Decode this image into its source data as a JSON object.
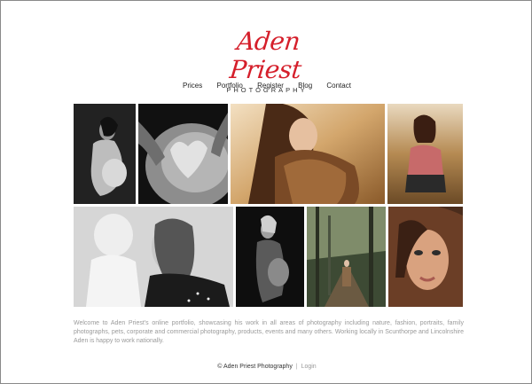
{
  "brand": {
    "name": "Aden Priest",
    "tagline": "PHOTOGRAPHY"
  },
  "nav": [
    "Prices",
    "Portfolio",
    "Register",
    "Blog",
    "Contact"
  ],
  "gallery": [
    {
      "name": "photo-pregnant-woman-silhouette",
      "tone": "mono"
    },
    {
      "name": "photo-hands-heart-on-belly",
      "tone": "mono"
    },
    {
      "name": "photo-woman-fur-coat-field",
      "tone": "warm"
    },
    {
      "name": "photo-woman-crouching-field",
      "tone": "warm"
    },
    {
      "name": "photo-mother-and-baby",
      "tone": "mono"
    },
    {
      "name": "photo-pregnant-woman-dark",
      "tone": "mono"
    },
    {
      "name": "photo-woman-in-woods",
      "tone": "green"
    },
    {
      "name": "photo-woman-closeup-portrait",
      "tone": "warm"
    }
  ],
  "intro_text": "Welcome to Aden Priest's online portfolio, showcasing his work in all areas of photography including nature, fashion, portraits, family photographs, pets, corporate and commercial photography, products, events and many others. Working locally in Scunthorpe and Lincolnshire Aden is happy to work nationally.",
  "footer": {
    "copyright": "© Aden Priest Photography",
    "separator": "|",
    "login": "Login"
  },
  "colors": {
    "accent": "#d51f2b",
    "text_muted": "#9a9a9a"
  }
}
